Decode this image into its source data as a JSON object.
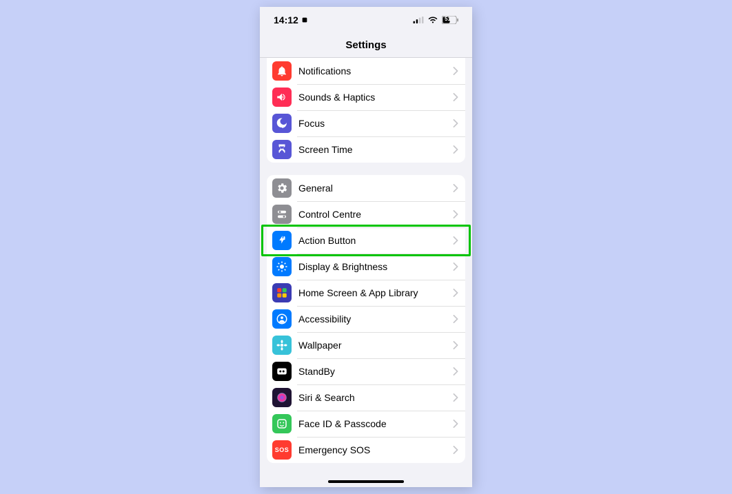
{
  "status": {
    "time": "14:12",
    "battery_label": "51"
  },
  "nav": {
    "title": "Settings"
  },
  "groups": [
    {
      "id": "group-a",
      "first": true,
      "rows": [
        {
          "id": "notifications",
          "label": "Notifications",
          "icon": "bell",
          "bg": "#ff3b30"
        },
        {
          "id": "sounds-haptics",
          "label": "Sounds & Haptics",
          "icon": "speaker",
          "bg": "#ff2d55"
        },
        {
          "id": "focus",
          "label": "Focus",
          "icon": "moon",
          "bg": "#5856d6"
        },
        {
          "id": "screen-time",
          "label": "Screen Time",
          "icon": "hourglass",
          "bg": "#5856d6"
        }
      ]
    },
    {
      "id": "group-b",
      "first": false,
      "rows": [
        {
          "id": "general",
          "label": "General",
          "icon": "gear",
          "bg": "#8e8e93"
        },
        {
          "id": "control-centre",
          "label": "Control Centre",
          "icon": "toggles",
          "bg": "#8e8e93"
        },
        {
          "id": "action-button",
          "label": "Action Button",
          "icon": "action",
          "bg": "#007aff",
          "highlighted": true
        },
        {
          "id": "display",
          "label": "Display & Brightness",
          "icon": "sun",
          "bg": "#007aff"
        },
        {
          "id": "home-screen",
          "label": "Home Screen & App Library",
          "icon": "grid",
          "bg": "#3b3bb3"
        },
        {
          "id": "accessibility",
          "label": "Accessibility",
          "icon": "person",
          "bg": "#007aff"
        },
        {
          "id": "wallpaper",
          "label": "Wallpaper",
          "icon": "flower",
          "bg": "#37c2d9"
        },
        {
          "id": "standby",
          "label": "StandBy",
          "icon": "standby",
          "bg": "#000000"
        },
        {
          "id": "siri",
          "label": "Siri & Search",
          "icon": "siri",
          "bg": "#1f1333"
        },
        {
          "id": "faceid",
          "label": "Face ID & Passcode",
          "icon": "face",
          "bg": "#34c759"
        },
        {
          "id": "sos",
          "label": "Emergency SOS",
          "icon": "sos",
          "bg": "#ff3b30"
        }
      ]
    }
  ]
}
